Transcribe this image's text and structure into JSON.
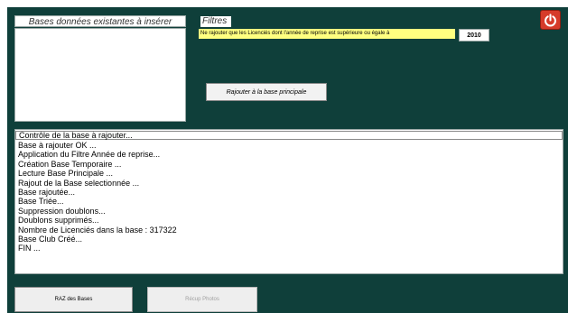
{
  "bases": {
    "label": "Bases données existantes à insérer",
    "items": []
  },
  "filtres": {
    "label": "Filtres",
    "text": "Ne rajouter que les Licenciés dont l'année de reprise est supérieure ou égale à",
    "year": "2010"
  },
  "actions": {
    "add_label": "Rajouter à la base principale",
    "raz_label": "RAZ des Bases",
    "recup_label": "Récup Photos"
  },
  "power": {
    "icon": "power-icon",
    "color": "#d63b2a"
  },
  "log": {
    "lines": [
      "Contrôle de la base à rajouter...",
      "Base à rajouter OK ...",
      "Application du Filtre Année de reprise...",
      "Création Base Temporaire ...",
      "Lecture Base Principale ...",
      "Rajout de la Base selectionnée ...",
      "Base rajoutée...",
      "Base Triée...",
      "Suppression doublons...",
      "Doublons supprimés...",
      "Nombre de Licenciés dans la base : 317322",
      "Base Club Créé...",
      "FIN ..."
    ]
  },
  "colors": {
    "background": "#0f3f3a",
    "filter_highlight": "#ffff80"
  }
}
